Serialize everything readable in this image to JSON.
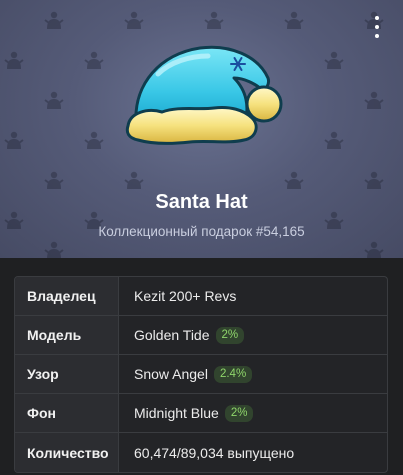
{
  "header": {
    "title": "Santa Hat",
    "subtitle": "Коллекционный подарок #54,165"
  },
  "icons": {
    "menu": "more-vertical-icon",
    "pattern": "snow-angel-icon",
    "gift": "santa-hat-icon"
  },
  "colors": {
    "background": "#464b64",
    "hat": "#4fd2ec",
    "fur": "#f5e27a",
    "badge_text": "#8fd66b"
  },
  "attributes": [
    {
      "label": "Владелец",
      "value": "Kezit 200+ Revs",
      "badge": ""
    },
    {
      "label": "Модель",
      "value": "Golden Tide",
      "badge": "2%"
    },
    {
      "label": "Узор",
      "value": "Snow Angel",
      "badge": "2.4%"
    },
    {
      "label": "Фон",
      "value": "Midnight Blue",
      "badge": "2%"
    },
    {
      "label": "Количество",
      "value": "60,474/89,034 выпущено",
      "badge": ""
    }
  ]
}
